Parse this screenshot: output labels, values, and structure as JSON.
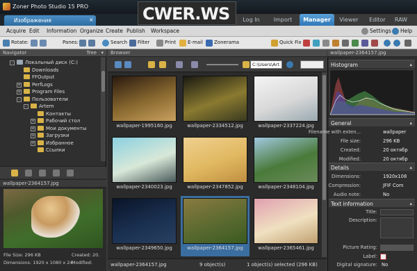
{
  "app": {
    "title": "Zoner Photo Studio 15 PRO",
    "doc_tab": "Изображения",
    "logo_text": "CWER.WS"
  },
  "modes": [
    {
      "label": "Log In"
    },
    {
      "label": "Import"
    },
    {
      "label": "Manager",
      "active": true
    },
    {
      "label": "Viewer"
    },
    {
      "label": "Editor"
    },
    {
      "label": "RAW"
    }
  ],
  "menu": [
    "Acquire",
    "Edit",
    "Information",
    "Organize",
    "Create",
    "Publish",
    "Workspace"
  ],
  "menu_right": {
    "settings": "Settings",
    "help": "Help"
  },
  "toolbar": {
    "rotate": "Rotate:",
    "panes": "Panes:",
    "search": "Search",
    "filter": "Filter",
    "print": "Print",
    "email": "E-mail",
    "zonerama": "Zonerama",
    "quickfix": "Quick Fix"
  },
  "navigator": {
    "title": "Navigator",
    "mode": "Tree",
    "tree": [
      {
        "label": "Локальный диск (C:)",
        "level": 1,
        "expander": "-",
        "icon": "drive-icon"
      },
      {
        "label": "Downloads",
        "level": 2,
        "expander": ""
      },
      {
        "label": "FFOutput",
        "level": 2,
        "expander": ""
      },
      {
        "label": "PerfLogs",
        "level": 2,
        "expander": "+"
      },
      {
        "label": "Program Files",
        "level": 2,
        "expander": "+"
      },
      {
        "label": "Пользователи",
        "level": 2,
        "expander": "-"
      },
      {
        "label": "Artem",
        "level": 3,
        "expander": "-"
      },
      {
        "label": "Контакты",
        "level": 4,
        "expander": ""
      },
      {
        "label": "Рабочий стол",
        "level": 4,
        "expander": "+"
      },
      {
        "label": "Мои документы",
        "level": 4,
        "expander": "+"
      },
      {
        "label": "Загрузки",
        "level": 4,
        "expander": "+"
      },
      {
        "label": "Избранное",
        "level": 4,
        "expander": "+"
      },
      {
        "label": "Ссылки",
        "level": 4,
        "expander": ""
      }
    ]
  },
  "preview": {
    "title": "wallpaper-2364157.jpg",
    "file_size": "File Size: 296 KB",
    "created": "Created: 20.",
    "dimensions": "Dimensions: 1920 x 1080 x 24",
    "modified": "Modified:"
  },
  "browser": {
    "title": "Browser",
    "path": "C:\\Users\\Art",
    "thumbs": [
      {
        "name": "wallpaper-1995160.jpg",
        "colors": [
          "#2a1a10",
          "#8a6a30",
          "#c9a060"
        ]
      },
      {
        "name": "wallpaper-2334512.jpg",
        "colors": [
          "#1a1a12",
          "#8a7a30",
          "#3a3a20"
        ]
      },
      {
        "name": "wallpaper-2337224.jpg",
        "colors": [
          "#f4f4f4",
          "#d8d8d8",
          "#9aaab0"
        ]
      },
      {
        "name": "wallpaper-2340023.jpg",
        "colors": [
          "#8ad0e0",
          "#d8e8d8",
          "#4a5a5a"
        ]
      },
      {
        "name": "wallpaper-2347852.jpg",
        "colors": [
          "#f0d090",
          "#e0b860",
          "#c09040"
        ]
      },
      {
        "name": "wallpaper-2348104.jpg",
        "colors": [
          "#a0c8e0",
          "#4a7a3a",
          "#6a8a5a"
        ]
      },
      {
        "name": "wallpaper-2349650.jpg",
        "colors": [
          "#0a1428",
          "#1a3050",
          "#2a4060"
        ]
      },
      {
        "name": "wallpaper-2364157.jpg",
        "colors": [
          "#8a7a40",
          "#5a6a30",
          "#3a5a20"
        ],
        "selected": true
      },
      {
        "name": "wallpaper-2365461.jpg",
        "colors": [
          "#e0a0b0",
          "#f0e0c0",
          "#c0a070"
        ]
      }
    ],
    "status_file": "wallpaper-2364157.jpg",
    "status_count": "9 object(s)",
    "status_selected": "1 object(s) selected (296 KB)"
  },
  "info": {
    "title": "wallpaper-2364157.jpg",
    "histogram_label": "Histogram",
    "general_label": "General",
    "general": [
      {
        "k": "Filename with exten...",
        "v": "wallpaper"
      },
      {
        "k": "File size:",
        "v": "296 KB"
      },
      {
        "k": "Created:",
        "v": "20 октябр"
      },
      {
        "k": "Modified:",
        "v": "20 октябр"
      }
    ],
    "details_label": "Details",
    "details": [
      {
        "k": "Dimensions:",
        "v": "1920x108"
      },
      {
        "k": "Compression:",
        "v": "JFIF Com"
      },
      {
        "k": "Audio note:",
        "v": "No"
      }
    ],
    "text_label": "Text information",
    "text": [
      {
        "k": "Title:",
        "v": ""
      },
      {
        "k": "Description:",
        "v": ""
      }
    ],
    "rating_label": "Picture Rating:",
    "label_label": "Label:",
    "digital_label": "Digital signature:",
    "digital_value": "No"
  },
  "colors": {
    "accent": "#2f78b8",
    "selected": "#3b6ea0"
  }
}
